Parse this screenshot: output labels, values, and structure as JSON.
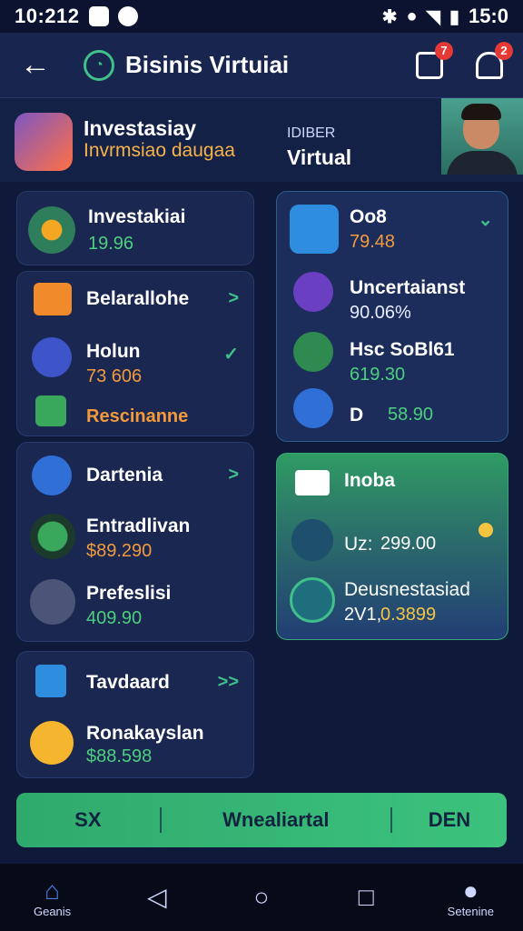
{
  "status": {
    "time": "10:212",
    "clock": "15:0"
  },
  "appbar": {
    "title": "Bisinis Virtuiai",
    "badge_count_1": "7",
    "badge_count_2": "2"
  },
  "hero": {
    "title": "Investasiay",
    "subtitle": "Invrmsiao daugaa",
    "label_small": "IDIBER",
    "label_big": "Virtual"
  },
  "left_cards": {
    "card1": {
      "label": "Investakiai",
      "value": "19.96"
    },
    "card2": {
      "item1": {
        "label": "Belarallohe"
      },
      "item2": {
        "label": "Holun",
        "value": "73 606"
      },
      "item3": {
        "label": "Rescinanne"
      }
    },
    "card3": {
      "item1": {
        "label": "Dartenia"
      },
      "item2": {
        "label": "Entradlivan",
        "value": "$89.290"
      },
      "item3": {
        "label": "Prefeslisi",
        "value": "409.90"
      }
    },
    "card4": {
      "item1": {
        "label": "Tavdaard"
      },
      "item2": {
        "label": "Ronakayslan",
        "value": "$88.598"
      }
    }
  },
  "right_cards": {
    "card1": {
      "item1": {
        "label": "Oo8",
        "value": "79.48"
      },
      "item2": {
        "label": "Uncertaianst",
        "value": "90.06%"
      },
      "item3": {
        "label": "Hsc SoBl61",
        "value": "619.30"
      },
      "item4": {
        "label": "D",
        "value": "58.90"
      }
    },
    "card2": {
      "title": "Inoba",
      "item1": {
        "label": "Uz:",
        "value": "299.00"
      },
      "item2": {
        "label": "Deusnestasiad",
        "value_a": "2V1,",
        "value_b": "0.3899"
      }
    }
  },
  "bottombar": {
    "seg1": "SX",
    "seg2": "Wnealiartal",
    "seg3": "DEN"
  },
  "nav": {
    "home_label": "Geanis",
    "settings_label": "Setenine"
  },
  "colors": {
    "accent_green": "#3fbf8a",
    "bg_navy": "#0f1a3a",
    "orange": "#f39a3d",
    "yellow": "#f5c542"
  }
}
